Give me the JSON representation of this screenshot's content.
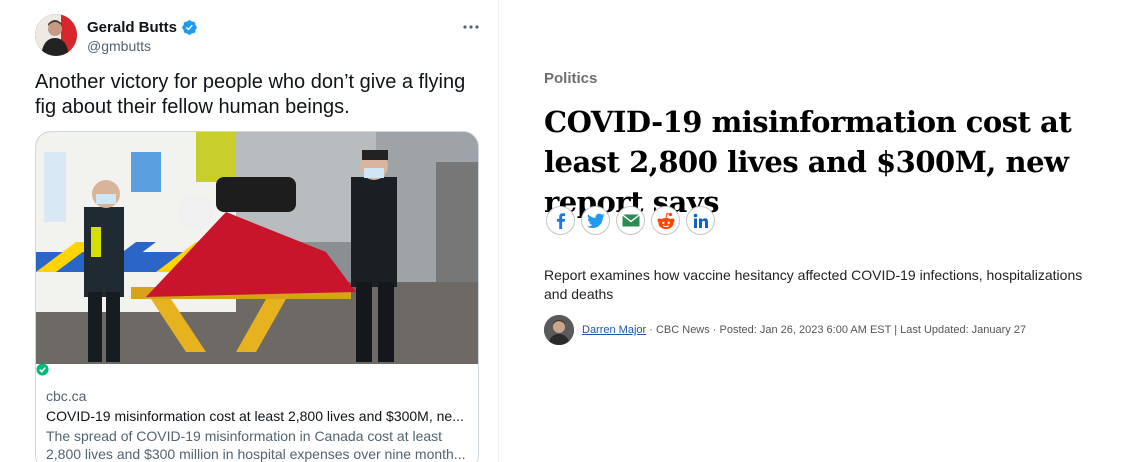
{
  "tweet": {
    "author_name": "Gerald Butts",
    "handle": "@gmbutts",
    "text": "Another victory for people who don’t give a flying fig about their fellow human beings.",
    "card": {
      "domain": "cbc.ca",
      "title": "COVID-19 misinformation cost at least 2,800 lives and $300M, ne...",
      "description": "The spread of COVID-19 misinformation in Canada cost at least 2,800 lives and $300 million in hospital expenses over nine month..."
    }
  },
  "article": {
    "category": "Politics",
    "headline": "COVID-19 misinformation cost at least 2,800 lives and $300M, new report says",
    "dek": "Report examines how vaccine hesitancy affected COVID-19 infections, hospitalizations and deaths",
    "byline": {
      "author": "Darren Major",
      "details": " · CBC News · Posted: Jan 26, 2023 6:00 AM EST | Last Updated: January 27"
    },
    "share_icons": [
      "facebook-icon",
      "twitter-icon",
      "email-icon",
      "reddit-icon",
      "linkedin-icon"
    ]
  },
  "colors": {
    "verified": "#1d9bf0",
    "link": "#2255aa",
    "facebook": "#1877f2",
    "twitter": "#1d9bf0",
    "email": "#2e8b57",
    "reddit": "#ff4500",
    "linkedin": "#0a66c2"
  }
}
